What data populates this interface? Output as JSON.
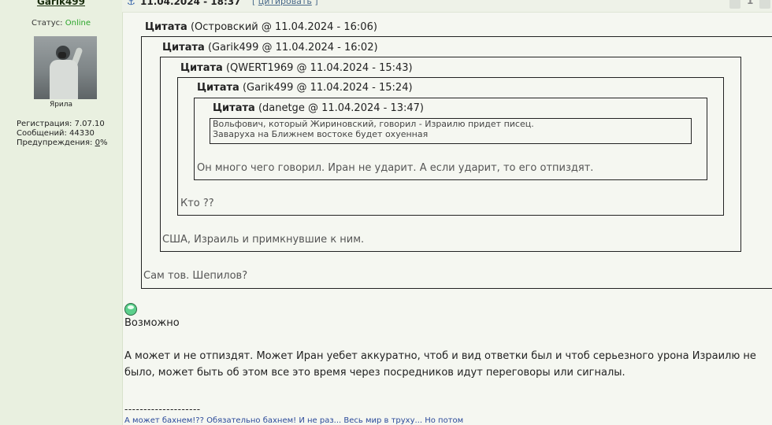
{
  "author": {
    "name": "Garik499",
    "status_label": "Статус:",
    "status_value": "Online",
    "rank": "Ярила",
    "registration": "Регистрация: 7.07.10",
    "messages": "Сообщений: 44330",
    "warnings_label": "Предупреждения:",
    "warnings_value": "0",
    "warnings_suffix": "%",
    "avatar_icon": "gas-mask-soldier-avatar"
  },
  "post": {
    "anchor_icon": "⚓",
    "datetime": "11.04.2024 - 18:37",
    "cite_open": "[",
    "cite_link": "цитировать",
    "cite_close": "]",
    "page_number": "1"
  },
  "quotes": [
    {
      "label": "Цитата",
      "meta": "(Островский @ 11.04.2024 - 16:06)",
      "reply": "Сам тов. Шепилов?"
    },
    {
      "label": "Цитата",
      "meta": "(Garik499 @ 11.04.2024 - 16:02)",
      "reply": "США, Израиль и примкнувшие к ним."
    },
    {
      "label": "Цитата",
      "meta": "(QWERT1969 @ 11.04.2024 - 15:43)",
      "reply": "Кто ??"
    },
    {
      "label": "Цитата",
      "meta": "(Garik499 @ 11.04.2024 - 15:24)",
      "reply": "Он много чего говорил. Иран не ударит. А если ударит, то его отпиздят."
    },
    {
      "label": "Цитата",
      "meta": "(danetge @ 11.04.2024 - 13:47)",
      "lines": [
        "Вольфович, который Жириновский, говорил - Израилю придет писец.",
        "Заваруха на Ближнем востоке будет охуенная"
      ]
    }
  ],
  "body": {
    "smiley_icon": "smiley-icon",
    "line1": "Возможно",
    "para1": "А может и не отпиздят. Может Иран уебет аккуратно, чтоб и вид ответки был и чтоб серьезного урона Израилю не",
    "para2": "было, может быть об этом все это время через посредников идут переговоры или сигналы.",
    "separator": "--------------------",
    "signature": "А может бахнем!?? Обязательно бахнем! И не раз... Весь мир в труху... Но потом"
  }
}
